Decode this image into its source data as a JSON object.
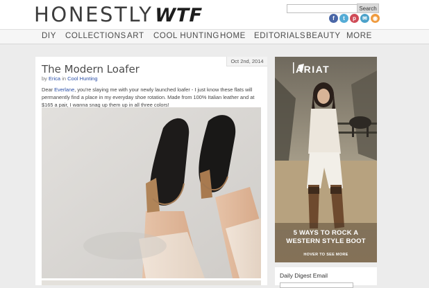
{
  "site": {
    "logo_main": "HONESTLY",
    "logo_accent": "WTF"
  },
  "search": {
    "value": "",
    "button_label": "Search"
  },
  "social": [
    {
      "name": "facebook-icon",
      "glyph": "f",
      "color": "#4a67a7"
    },
    {
      "name": "twitter-icon",
      "glyph": "t",
      "color": "#55acd6"
    },
    {
      "name": "pinterest-icon",
      "glyph": "p",
      "color": "#cf4a56"
    },
    {
      "name": "email-icon",
      "glyph": "✉",
      "color": "#4ba1c9"
    },
    {
      "name": "rss-icon",
      "glyph": "◉",
      "color": "#ef9b3f"
    }
  ],
  "nav": [
    "DIY",
    "COLLECTIONS",
    "ART",
    "COOL HUNTING",
    "HOME",
    "EDITORIALS",
    "BEAUTY",
    "MORE"
  ],
  "post": {
    "date": "Oct 2nd, 2014",
    "title": "The Modern Loafer",
    "by": "by",
    "author": "Erica",
    "in": "in",
    "category": "Cool Hunting",
    "body_pre": "Dear ",
    "body_link": "Everlane",
    "body_post": ", you're slaying me with your newly launched loafer - I just know these flats will permanently find a place in my everyday shoe rotation. Made from 100% Italian leather and at $165 a pair, I wanna snag up them up in all three colors!"
  },
  "ad": {
    "brand": "ARIAT",
    "headline_line1": "5 WAYS TO ROCK A",
    "headline_line2": "WESTERN STYLE BOOT",
    "cta": "HOVER TO SEE MORE"
  },
  "newsletter": {
    "label": "Daily Digest Email"
  },
  "colors": {
    "link": "#2b4fa6",
    "page_bg": "#ececec",
    "nav_text": "#4b4b4b"
  }
}
